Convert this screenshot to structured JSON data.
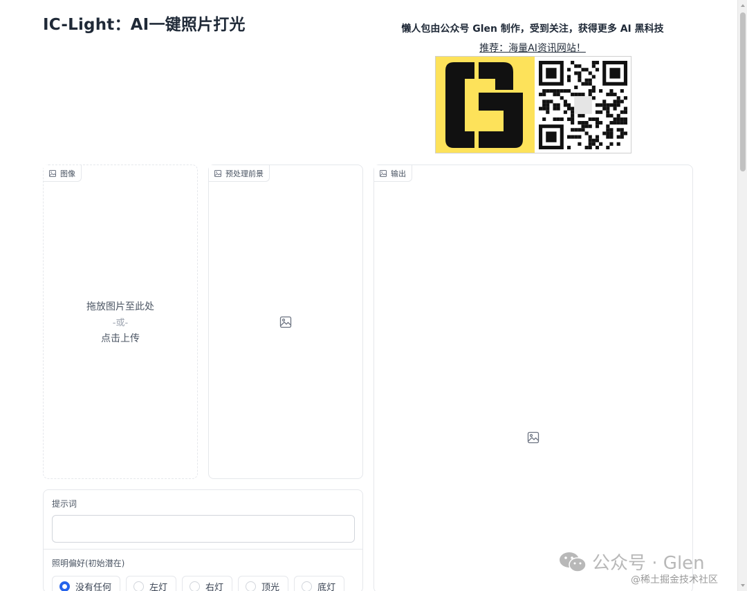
{
  "app": {
    "title": "IC-Light：AI一键照片打光"
  },
  "promo": {
    "text": "懒人包由公众号 Glen 制作，受到关注，获得更多 AI 黑科技",
    "link": "推荐：海量AI资讯网站！"
  },
  "panels": {
    "image": {
      "label": "图像",
      "drop_line1": "拖放图片至此处",
      "drop_or": "-或-",
      "drop_line2": "点击上传"
    },
    "preprocess": {
      "label": "预处理前景"
    },
    "output": {
      "label": "输出"
    }
  },
  "form": {
    "prompt_label": "提示词",
    "prompt_value": "",
    "lighting_label": "照明偏好(初始潜在)",
    "lighting_options": [
      "没有任何",
      "左灯",
      "右灯",
      "顶光",
      "底灯"
    ],
    "lighting_selected": "没有任何"
  },
  "watermark": {
    "main": "公众号 · Glen",
    "sub": "@稀土掘金技术社区"
  },
  "icons": {
    "image_label_icon": "image-icon",
    "placeholder_icon": "image-placeholder-icon",
    "wechat": "wechat-icon"
  },
  "colors": {
    "accent": "#2563eb",
    "banner_yellow": "#fde25a"
  }
}
